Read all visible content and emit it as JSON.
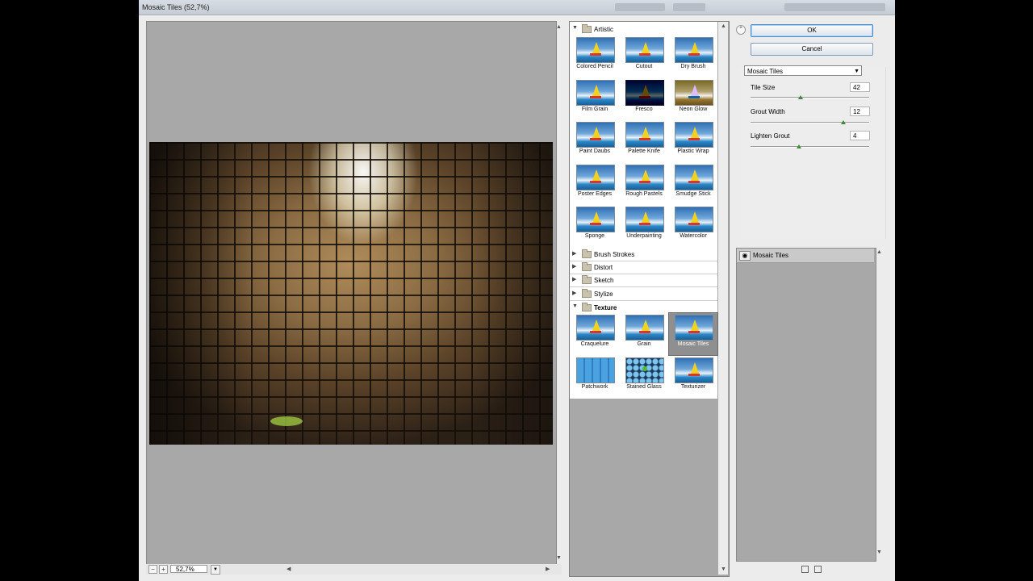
{
  "window": {
    "title": "Mosaic Tiles (52,7%)"
  },
  "preview": {
    "zoom_value": "52,7%",
    "zoom_out": "−",
    "zoom_in": "+"
  },
  "gallery": {
    "categories": {
      "artistic": "Artistic",
      "brush_strokes": "Brush Strokes",
      "distort": "Distort",
      "sketch": "Sketch",
      "stylize": "Stylize",
      "texture": "Texture"
    },
    "artistic_filters": [
      "Colored Pencil",
      "Cutout",
      "Dry Brush",
      "Film Grain",
      "Fresco",
      "Neon Glow",
      "Paint Daubs",
      "Palette Knife",
      "Plastic Wrap",
      "Poster Edges",
      "Rough Pastels",
      "Smudge Stick",
      "Sponge",
      "Underpainting",
      "Watercolor"
    ],
    "texture_filters": [
      "Craquelure",
      "Grain",
      "Mosaic Tiles",
      "Patchwork",
      "Stained Glass",
      "Texturizer"
    ],
    "selected": "Mosaic Tiles"
  },
  "dialog": {
    "ok_label": "OK",
    "cancel_label": "Cancel"
  },
  "settings": {
    "filter_name": "Mosaic Tiles",
    "params": [
      {
        "label": "Tile Size",
        "value": "42",
        "fraction": 0.42
      },
      {
        "label": "Grout Width",
        "value": "12",
        "fraction": 0.78
      },
      {
        "label": "Lighten Grout",
        "value": "4",
        "fraction": 0.41
      }
    ]
  },
  "layers": {
    "items": [
      {
        "label": "Mosaic Tiles"
      }
    ]
  }
}
